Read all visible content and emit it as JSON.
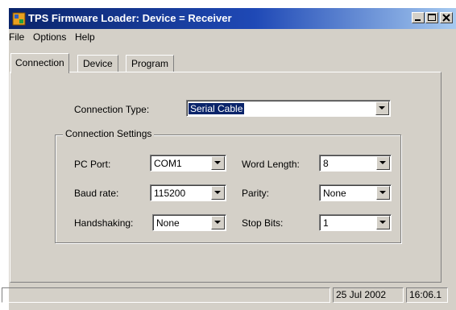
{
  "window": {
    "title": "TPS Firmware Loader:  Device = Receiver"
  },
  "menu": [
    "File",
    "Options",
    "Help"
  ],
  "tabs": [
    "Connection",
    "Device",
    "Program"
  ],
  "connection_type": {
    "label": "Connection Type:",
    "value": "Serial Cable"
  },
  "group": {
    "title": "Connection Settings",
    "pc_port": {
      "label": "PC Port:",
      "value": "COM1"
    },
    "baud_rate": {
      "label": "Baud rate:",
      "value": "115200"
    },
    "handshaking": {
      "label": "Handshaking:",
      "value": "None"
    },
    "word_length": {
      "label": "Word Length:",
      "value": "8"
    },
    "parity": {
      "label": "Parity:",
      "value": "None"
    },
    "stop_bits": {
      "label": "Stop Bits:",
      "value": "1"
    }
  },
  "status": {
    "main": "",
    "date": "25 Jul 2002",
    "time": "16:06.1"
  },
  "colors": {
    "title_active": "#0a246a",
    "face": "#d4d0c8",
    "selection": "#0a246a"
  }
}
